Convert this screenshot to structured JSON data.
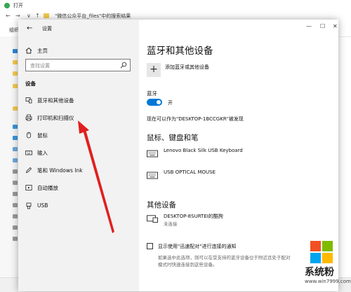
{
  "background_window": {
    "title": "打开",
    "address": "\"微信公众平台_files\"中的搜索结果",
    "toolbar_label": "组织"
  },
  "settings": {
    "window_title": "设置",
    "home_label": "主页",
    "search_placeholder": "查找设置",
    "section_label": "设备",
    "nav_items": [
      {
        "label": "蓝牙和其他设备",
        "icon": "bluetooth-devices-icon"
      },
      {
        "label": "打印机和扫描仪",
        "icon": "printer-icon"
      },
      {
        "label": "鼠标",
        "icon": "mouse-icon"
      },
      {
        "label": "输入",
        "icon": "keyboard-icon"
      },
      {
        "label": "笔和 Windows Ink",
        "icon": "pen-icon"
      },
      {
        "label": "自动播放",
        "icon": "autoplay-icon"
      },
      {
        "label": "USB",
        "icon": "usb-icon"
      }
    ],
    "page_title": "蓝牙和其他设备",
    "add_device_label": "添加蓝牙或其他设备",
    "bluetooth_heading": "蓝牙",
    "bluetooth_state": "开",
    "bluetooth_on": true,
    "discoverable_text": "现在可以作为\"DESKTOP-1BCCGKR\"被发现",
    "input_section_title": "鼠标、键盘和笔",
    "input_devices": [
      {
        "name": "Lenovo Black Silk USB Keyboard",
        "icon": "keyboard-icon"
      },
      {
        "name": "USB OPTICAL MOUSE",
        "icon": "keyboard-icon"
      }
    ],
    "other_section_title": "其他设备",
    "other_devices": [
      {
        "name": "DESKTOP-8SURTEI的酷狗",
        "status": "未连接",
        "icon": "display-device-icon"
      }
    ],
    "swift_pair_label": "显示使用\"迅速配对\"进行连接的通知",
    "swift_pair_checked": false,
    "swift_pair_hint_line1": "如果选中此选项，则可以在受支持的蓝牙设备位于附近且处于配对",
    "swift_pair_hint_line2": "模式时快速连接到这些设备。"
  },
  "watermark": {
    "text": "系统粉",
    "url": "www.win7999.com"
  },
  "colors": {
    "accent": "#0078d7",
    "annotation_arrow": "#e02020",
    "sidebar_bg": "#f2f2f2",
    "ms_red": "#f25022",
    "ms_green": "#7fba00",
    "ms_blue": "#00a4ef",
    "ms_yellow": "#ffb900"
  }
}
